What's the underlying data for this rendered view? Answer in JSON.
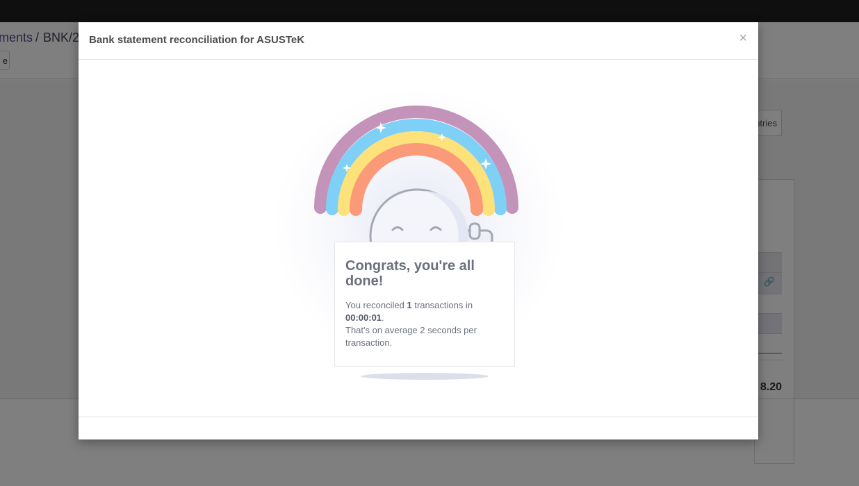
{
  "background": {
    "breadcrumb": {
      "first": "ments",
      "separator": "/",
      "current": "BNK/2"
    },
    "button_label": "e",
    "entries_button_label": "ntries",
    "link_icon": "🔗",
    "total_value": "8.20"
  },
  "modal": {
    "title": "Bank statement reconciliation for ASUSTeK",
    "close_glyph": "×",
    "illustration": "rainbow-smiley-thumbs-up",
    "card": {
      "title": "Congrats, you're all done!",
      "line1_prefix": "You reconciled ",
      "transactions_count": "1",
      "line1_suffix": " transactions in",
      "duration": "00:00:01",
      "line2_end": ".",
      "line3": "That's on average 2 seconds per transaction."
    }
  },
  "colors": {
    "rainbow_purple": "#c493b9",
    "rainbow_blue": "#7fd0f7",
    "rainbow_yellow": "#fde17a",
    "rainbow_orange": "#fb9a78",
    "face_stroke": "#a3a8b4",
    "face_fill": "#f4f5fb",
    "topbar": "#1e1e1e"
  }
}
